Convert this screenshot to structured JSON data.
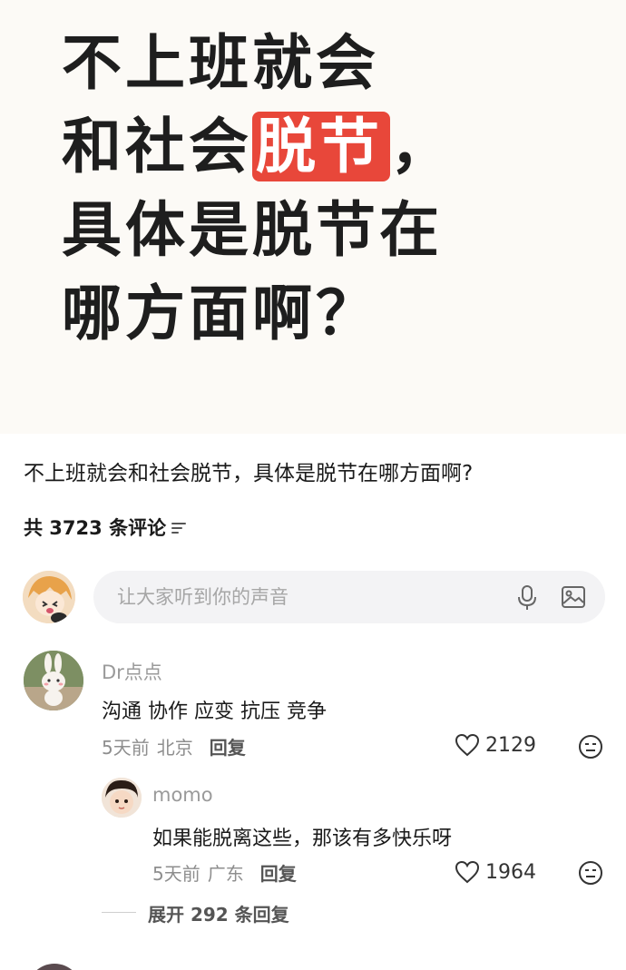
{
  "hero": {
    "line1": "不上班就会",
    "line2_before": "和社会",
    "line2_highlight": "脱节",
    "line2_after": "，",
    "line3": "具体是脱节在",
    "line4": "哪方面啊？",
    "highlight_color": "#e8473a"
  },
  "post": {
    "title": "不上班就会和社会脱节，具体是脱节在哪方面啊?",
    "comment_count_text": "共 3723 条评论"
  },
  "composer": {
    "placeholder": "让大家听到你的声音"
  },
  "comments": [
    {
      "username": "Dr点点",
      "content": "沟通 协作 应变 抗压 竞争",
      "time": "5天前",
      "location": "北京",
      "reply_label": "回复",
      "likes": "2129"
    }
  ],
  "replies": [
    {
      "username": "momo",
      "content": "如果能脱离这些，那该有多快乐呀",
      "time": "5天前",
      "location": "广东",
      "reply_label": "回复",
      "likes": "1964"
    }
  ],
  "expand_text": "展开 292 条回复",
  "icons": [
    "sort-icon",
    "mic-icon",
    "image-icon",
    "heart-icon",
    "emoji-icon"
  ]
}
